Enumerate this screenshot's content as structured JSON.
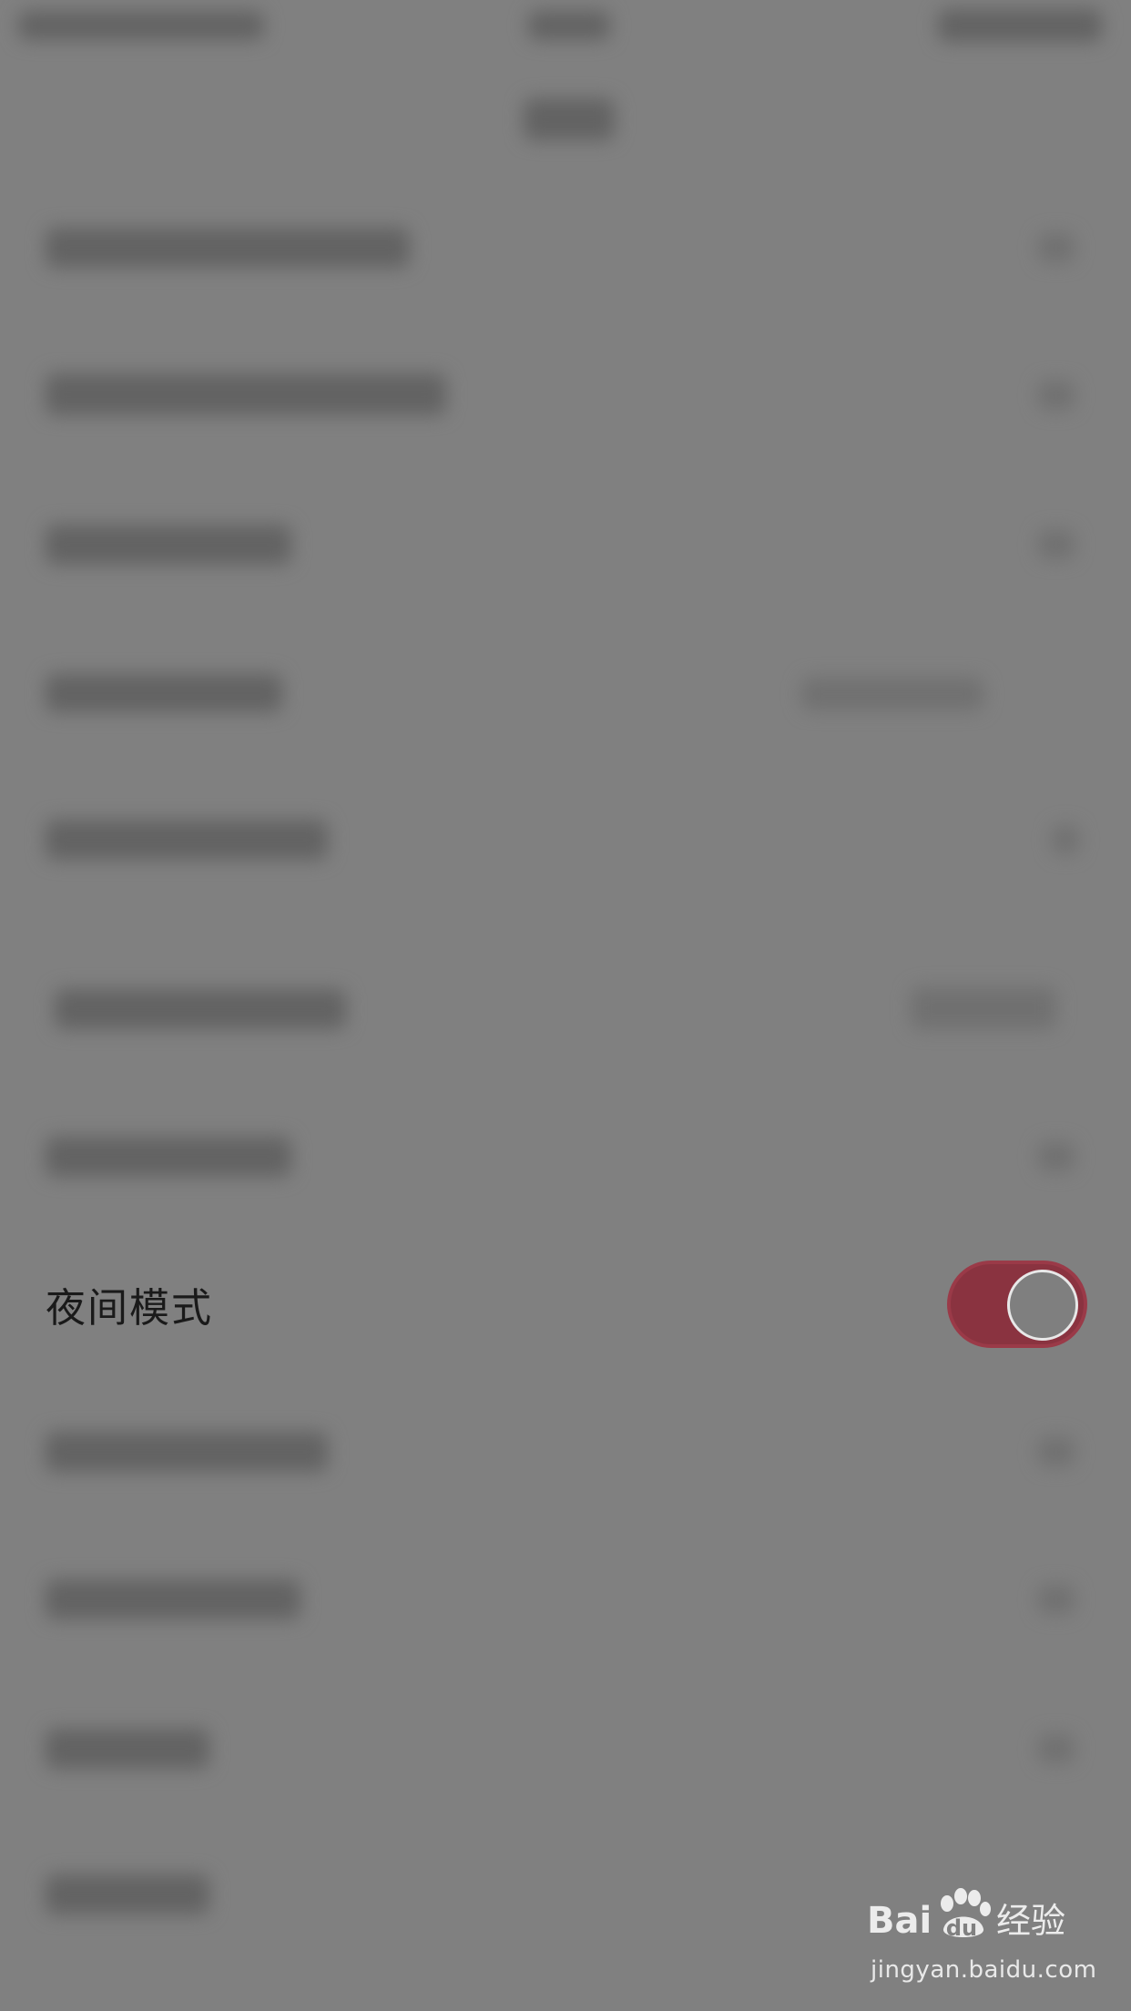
{
  "settings": {
    "night_mode": {
      "label": "夜间模式",
      "enabled": true
    }
  },
  "watermark": {
    "logo_text": "Bai经验",
    "url": "jingyan.baidu.com"
  },
  "colors": {
    "overlay": "#808080",
    "toggle_on": "#8a3340",
    "text": "#1a1a1a"
  }
}
